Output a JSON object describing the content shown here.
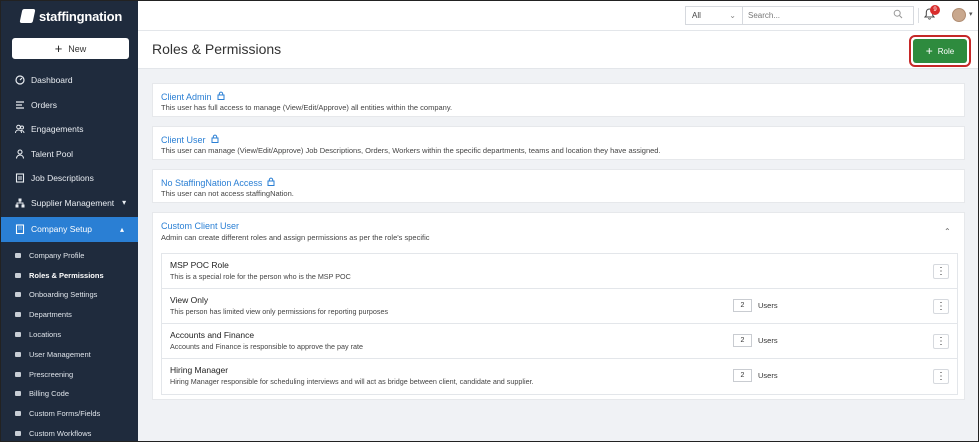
{
  "app": {
    "brand": "staffingnation"
  },
  "sidebar": {
    "new_label": "New",
    "items": [
      {
        "label": "Dashboard",
        "icon": "gauge-icon"
      },
      {
        "label": "Orders",
        "icon": "list-icon"
      },
      {
        "label": "Engagements",
        "icon": "people-icon"
      },
      {
        "label": "Talent Pool",
        "icon": "person-icon"
      },
      {
        "label": "Job Descriptions",
        "icon": "document-icon"
      },
      {
        "label": "Supplier Management",
        "icon": "org-icon"
      },
      {
        "label": "Company Setup",
        "icon": "building-icon"
      }
    ],
    "sub_items": [
      "Company Profile",
      "Roles & Permissions",
      "Onboarding Settings",
      "Departments",
      "Locations",
      "User Management",
      "Prescreening",
      "Billing Code",
      "Custom Forms/Fields",
      "Custom Workflows"
    ]
  },
  "topbar": {
    "filter_value": "All",
    "search_placeholder": "Search...",
    "notification_count": "9"
  },
  "header": {
    "title": "Roles & Permissions",
    "add_role_label": "Role"
  },
  "cards": [
    {
      "title": "Client Admin",
      "desc": "This user has full access to manage (View/Edit/Approve) all entities within the company."
    },
    {
      "title": "Client User",
      "desc": "This user can manage (View/Edit/Approve) Job Descriptions, Orders, Workers within the specific departments, teams and location they have assigned."
    },
    {
      "title": "No StaffingNation Access",
      "desc": "This user can not access staffingNation."
    },
    {
      "title": "Custom Client User",
      "desc": "Admin can create different roles and assign permissions as per the role's specific"
    }
  ],
  "custom_roles": [
    {
      "name": "MSP POC Role",
      "desc": "This is a special role for the person who is the MSP POC",
      "count": "",
      "users_label": ""
    },
    {
      "name": "View Only",
      "desc": "This person has limited view only permissions for reporting purposes",
      "count": "2",
      "users_label": "Users"
    },
    {
      "name": "Accounts and Finance",
      "desc": "Accounts and Finance is responsible to approve the pay rate",
      "count": "2",
      "users_label": "Users"
    },
    {
      "name": "Hiring Manager",
      "desc": "Hiring Manager responsible for scheduling interviews and will act as bridge between client, candidate and supplier.",
      "count": "2",
      "users_label": "Users"
    }
  ],
  "colors": {
    "sidebar_bg": "#1f2b3d",
    "accent": "#2a7fd4",
    "primary_button": "#2e8b3e",
    "highlight_outline": "#c62828"
  }
}
